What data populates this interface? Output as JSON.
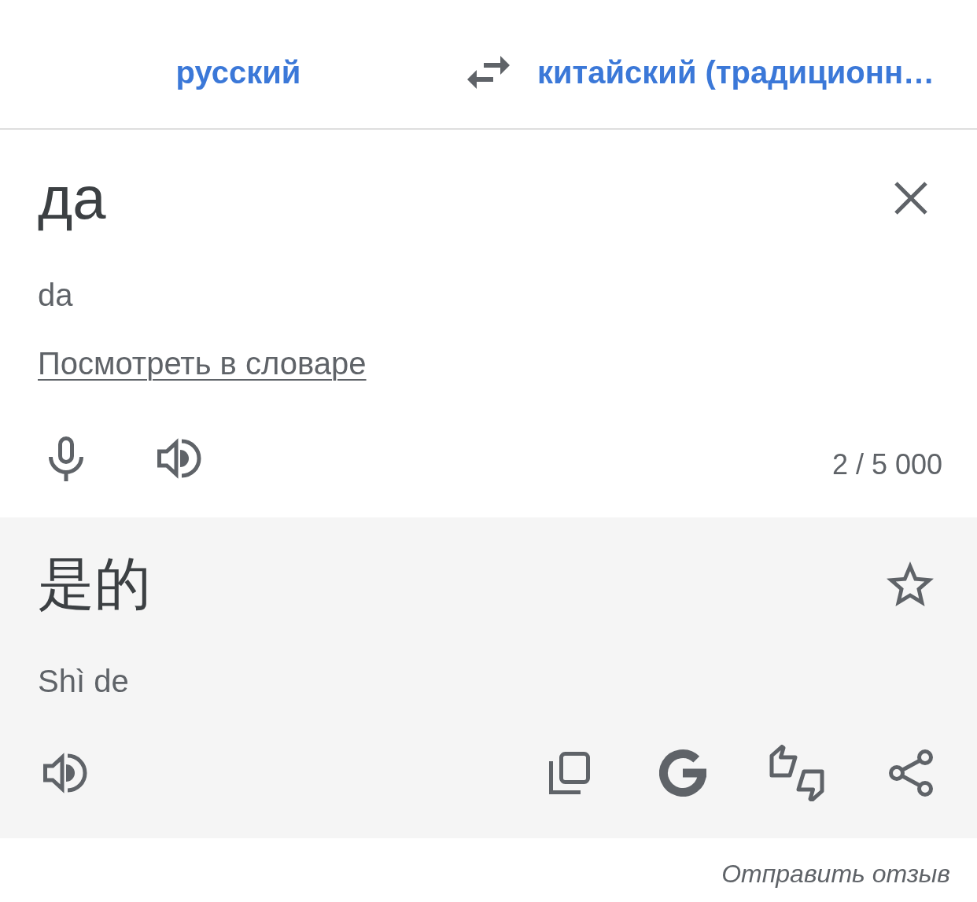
{
  "language_bar": {
    "source_language": "русский",
    "target_language": "китайский (традиционн…"
  },
  "source": {
    "text": "да",
    "transliteration": "da",
    "dictionary_link": "Посмотреть в словаре",
    "character_count": "2 / 5 000"
  },
  "translation": {
    "text": "是的",
    "transliteration": "Shì de",
    "saved": false
  },
  "footer": {
    "feedback_link": "Отправить отзыв"
  }
}
